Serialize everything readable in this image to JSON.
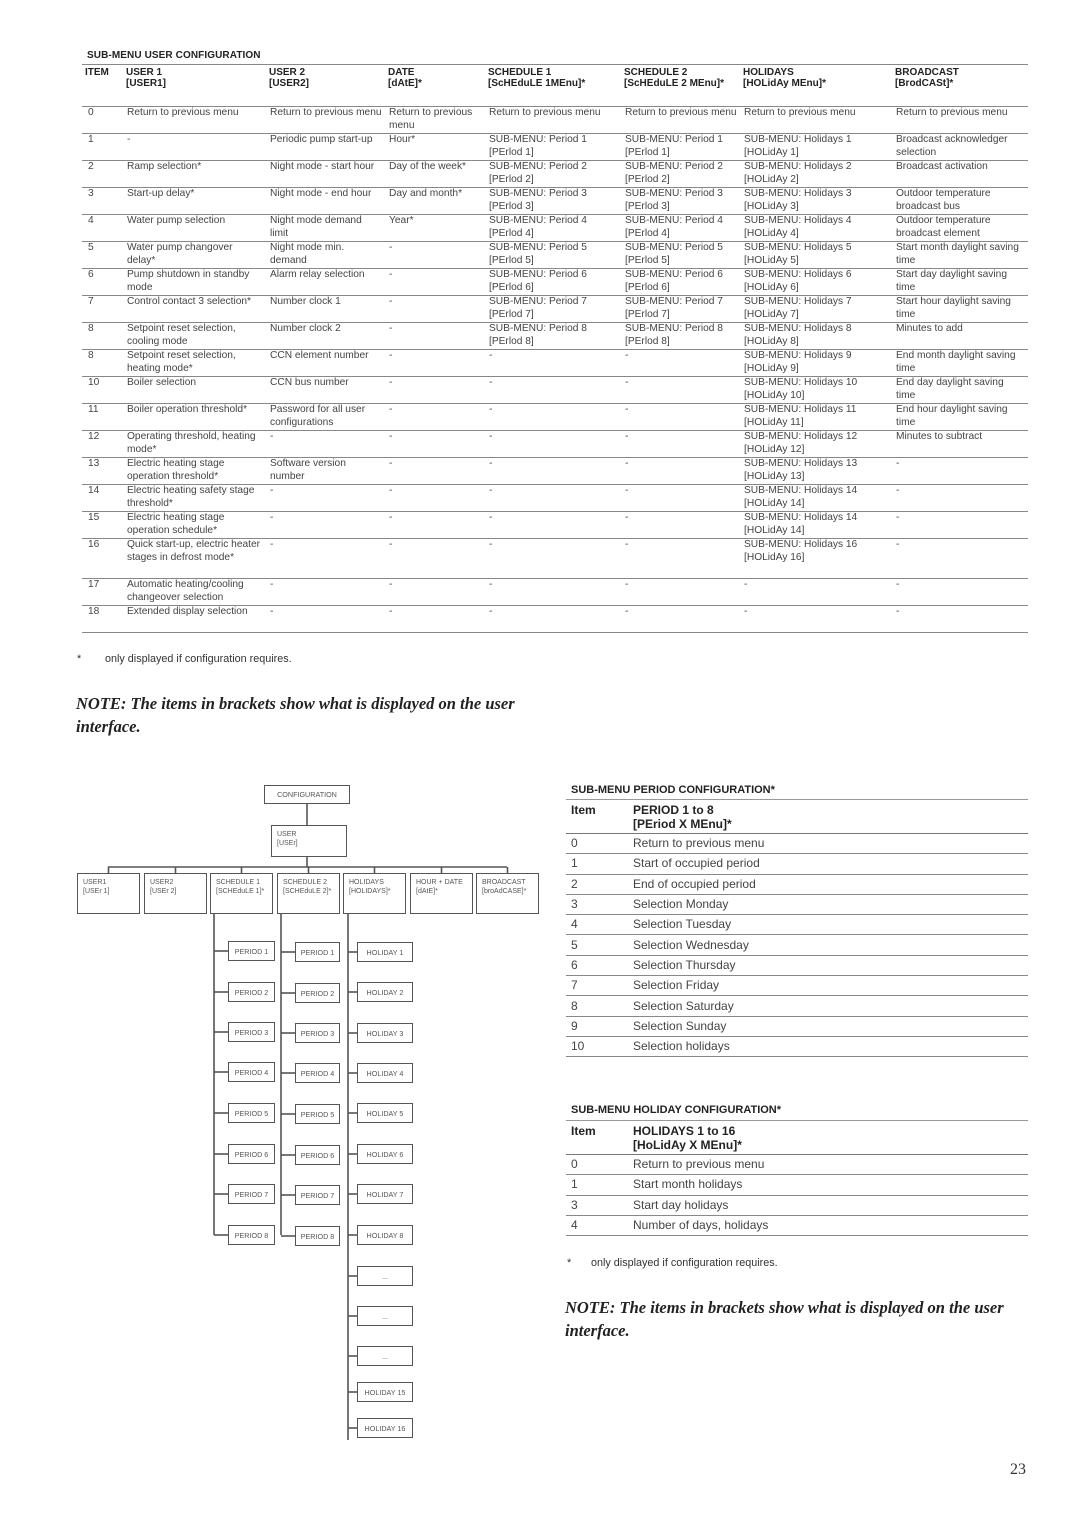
{
  "user_config": {
    "title": "SUB-MENU USER CONFIGURATION",
    "headers": [
      {
        "l1": "ITEM",
        "l2": ""
      },
      {
        "l1": "USER 1",
        "l2": "[USER1]"
      },
      {
        "l1": "USER 2",
        "l2": "[USER2]"
      },
      {
        "l1": "DATE",
        "l2": "[dAtE]*"
      },
      {
        "l1": "SCHEDULE 1",
        "l2": "[ScHEduLE 1MEnu]*"
      },
      {
        "l1": "SCHEDULE 2",
        "l2": "[ScHEduLE 2 MEnu]*"
      },
      {
        "l1": "HOLIDAYS",
        "l2": "[HOLidAy MEnu]*"
      },
      {
        "l1": "BROADCAST",
        "l2": "[BrodCASt]*"
      }
    ],
    "rows": [
      [
        "0",
        "Return to previous menu",
        "Return to previous menu",
        "Return to previous menu",
        "Return to previous menu",
        "Return to previous menu",
        "Return to previous menu",
        "Return to previous menu"
      ],
      [
        "1",
        "-",
        "Periodic pump start-up",
        "Hour*",
        "SUB-MENU: Period 1 [PErlod 1]",
        "SUB-MENU: Period 1 [PErlod 1]",
        "SUB-MENU: Holidays 1 [HOLidAy 1]",
        "Broadcast acknowledger selection"
      ],
      [
        "2",
        "Ramp selection*",
        "Night mode - start hour",
        "Day of the week*",
        "SUB-MENU: Period 2 [PErlod 2]",
        "SUB-MENU: Period 2 [PErlod 2]",
        "SUB-MENU: Holidays 2 [HOLidAy 2]",
        "Broadcast activation"
      ],
      [
        "3",
        "Start-up delay*",
        "Night mode - end hour",
        "Day and month*",
        "SUB-MENU: Period 3 [PErlod 3]",
        "SUB-MENU: Period 3 [PErlod 3]",
        "SUB-MENU: Holidays 3 [HOLidAy 3]",
        "Outdoor temperature broadcast bus"
      ],
      [
        "4",
        "Water pump selection",
        "Night mode demand limit",
        "Year*",
        "SUB-MENU: Period 4 [PErlod 4]",
        "SUB-MENU: Period 4 [PErlod 4]",
        "SUB-MENU: Holidays 4 [HOLidAy 4]",
        "Outdoor temperature broadcast element"
      ],
      [
        "5",
        "Water pump changover delay*",
        "Night mode min. demand",
        "-",
        "SUB-MENU: Period 5 [PErlod 5]",
        "SUB-MENU: Period 5 [PErlod 5]",
        "SUB-MENU: Holidays 5 [HOLidAy 5]",
        "Start month daylight saving time"
      ],
      [
        "6",
        "Pump shutdown in standby mode",
        "Alarm relay selection",
        "-",
        "SUB-MENU: Period 6 [PErlod 6]",
        "SUB-MENU: Period 6 [PErlod 6]",
        "SUB-MENU: Holidays 6 [HOLidAy 6]",
        "Start day daylight saving time"
      ],
      [
        "7",
        "Control contact 3 selection*",
        "Number clock 1",
        "-",
        "SUB-MENU: Period 7 [PErlod 7]",
        "SUB-MENU: Period 7 [PErlod 7]",
        "SUB-MENU: Holidays 7 [HOLidAy 7]",
        "Start hour daylight saving time"
      ],
      [
        "8",
        "Setpoint reset selection, cooling mode",
        "Number clock 2",
        "-",
        "SUB-MENU: Period 8 [PErlod 8]",
        "SUB-MENU: Period 8 [PErlod 8]",
        "SUB-MENU: Holidays 8 [HOLidAy 8]",
        "Minutes to add"
      ],
      [
        "8",
        "Setpoint reset selection, heating mode*",
        "CCN element number",
        "-",
        "-",
        "-",
        "SUB-MENU: Holidays 9 [HOLidAy 9]",
        "End month daylight saving time"
      ],
      [
        "10",
        "Boiler selection",
        "CCN bus number",
        "-",
        "-",
        "-",
        "SUB-MENU: Holidays 10 [HOLidAy 10]",
        "End day daylight saving time"
      ],
      [
        "11",
        "Boiler operation threshold*",
        "Password for all user configurations",
        "-",
        "-",
        "-",
        "SUB-MENU: Holidays 11 [HOLidAy 11]",
        "End hour daylight saving time"
      ],
      [
        "12",
        "Operating threshold, heating mode*",
        "-",
        "-",
        "-",
        "-",
        "SUB-MENU: Holidays 12 [HOLidAy 12]",
        "Minutes to subtract"
      ],
      [
        "13",
        "Electric heating stage operation threshold*",
        "Software version number",
        "-",
        "-",
        "-",
        "SUB-MENU: Holidays 13 [HOLidAy 13]",
        "-"
      ],
      [
        "14",
        "Electric heating safety stage threshold*",
        "-",
        "-",
        "-",
        "-",
        "SUB-MENU: Holidays 14 [HOLidAy 14]",
        "-"
      ],
      [
        "15",
        "Electric heating stage operation schedule*",
        "-",
        "-",
        "-",
        "-",
        "SUB-MENU: Holidays 14 [HOLidAy 14]",
        "-"
      ],
      [
        "16",
        "Quick start-up, electric heater stages in defrost mode*",
        "-",
        "-",
        "-",
        "-",
        "SUB-MENU: Holidays 16 [HOLidAy 16]",
        "-"
      ],
      [
        "17",
        "Automatic heating/cooling changeover selection",
        "-",
        "-",
        "-",
        "-",
        "-",
        "-"
      ],
      [
        "18",
        "Extended display selection",
        "-",
        "-",
        "-",
        "-",
        "-",
        "-"
      ]
    ],
    "footnote_mark": "*",
    "footnote": "only displayed if configuration requires."
  },
  "note_left": "NOTE: The items in brackets show what is displayed on the user interface.",
  "diagram": {
    "root": "CONFIGURATION",
    "user": {
      "l1": "USER",
      "l2": "[USEr]"
    },
    "children": [
      {
        "l1": "USER1",
        "l2": "[USEr 1]"
      },
      {
        "l1": "USER2",
        "l2": "[USEr 2]"
      },
      {
        "l1": "SCHEDULE 1",
        "l2": "[SCHEduLE 1]*"
      },
      {
        "l1": "SCHEDULE 2",
        "l2": "[SCHEduLE 2]*"
      },
      {
        "l1": "HOLIDAYS",
        "l2": "[HOLIDAYS]*"
      },
      {
        "l1": "HOUR + DATE",
        "l2": "[dAtE]*"
      },
      {
        "l1": "BROADCAST",
        "l2": "[broAdCASE]*"
      }
    ],
    "schedule1_periods": [
      "PERIOD 1",
      "PERIOD 2",
      "PERIOD 3",
      "PERIOD 4",
      "PERIOD 5",
      "PERIOD 6",
      "PERIOD 7",
      "PERIOD 8"
    ],
    "schedule2_periods": [
      "PERIOD 1",
      "PERIOD 2",
      "PERIOD 3",
      "PERIOD 4",
      "PERIOD 5",
      "PERIOD 6",
      "PERIOD 7",
      "PERIOD 8"
    ],
    "holidays": [
      "HOLIDAY 1",
      "HOLIDAY 2",
      "HOLIDAY 3",
      "HOLIDAY 4",
      "HOLIDAY 5",
      "HOLIDAY 6",
      "HOLIDAY 7",
      "HOLIDAY 8",
      "...",
      "...",
      "...",
      "HOLIDAY 15",
      "HOLIDAY 16"
    ]
  },
  "period_config": {
    "title": "SUB-MENU PERIOD CONFIGURATION*",
    "header_item": "Item",
    "header_l1": "PERIOD 1 to 8",
    "header_l2": "[PEriod X MEnu]*",
    "rows": [
      [
        "0",
        "Return to previous menu"
      ],
      [
        "1",
        "Start of occupied period"
      ],
      [
        "2",
        "End of occupied period"
      ],
      [
        "3",
        "Selection Monday"
      ],
      [
        "4",
        "Selection Tuesday"
      ],
      [
        "5",
        "Selection Wednesday"
      ],
      [
        "6",
        "Selection Thursday"
      ],
      [
        "7",
        "Selection Friday"
      ],
      [
        "8",
        "Selection Saturday"
      ],
      [
        "9",
        "Selection Sunday"
      ],
      [
        "10",
        "Selection holidays"
      ]
    ]
  },
  "holiday_config": {
    "title": "SUB-MENU HOLIDAY CONFIGURATION*",
    "header_item": "Item",
    "header_l1": "HOLIDAYS 1 to 16",
    "header_l2": "[HoLidAy X MEnu]*",
    "rows": [
      [
        "0",
        "Return to previous menu"
      ],
      [
        "1",
        "Start month holidays"
      ],
      [
        "3",
        "Start day holidays"
      ],
      [
        "4",
        "Number of days, holidays"
      ]
    ],
    "footnote_mark": "*",
    "footnote": "only displayed if configuration requires."
  },
  "note_right": "NOTE: The items in brackets show what is displayed on the user interface.",
  "page_number": "23"
}
